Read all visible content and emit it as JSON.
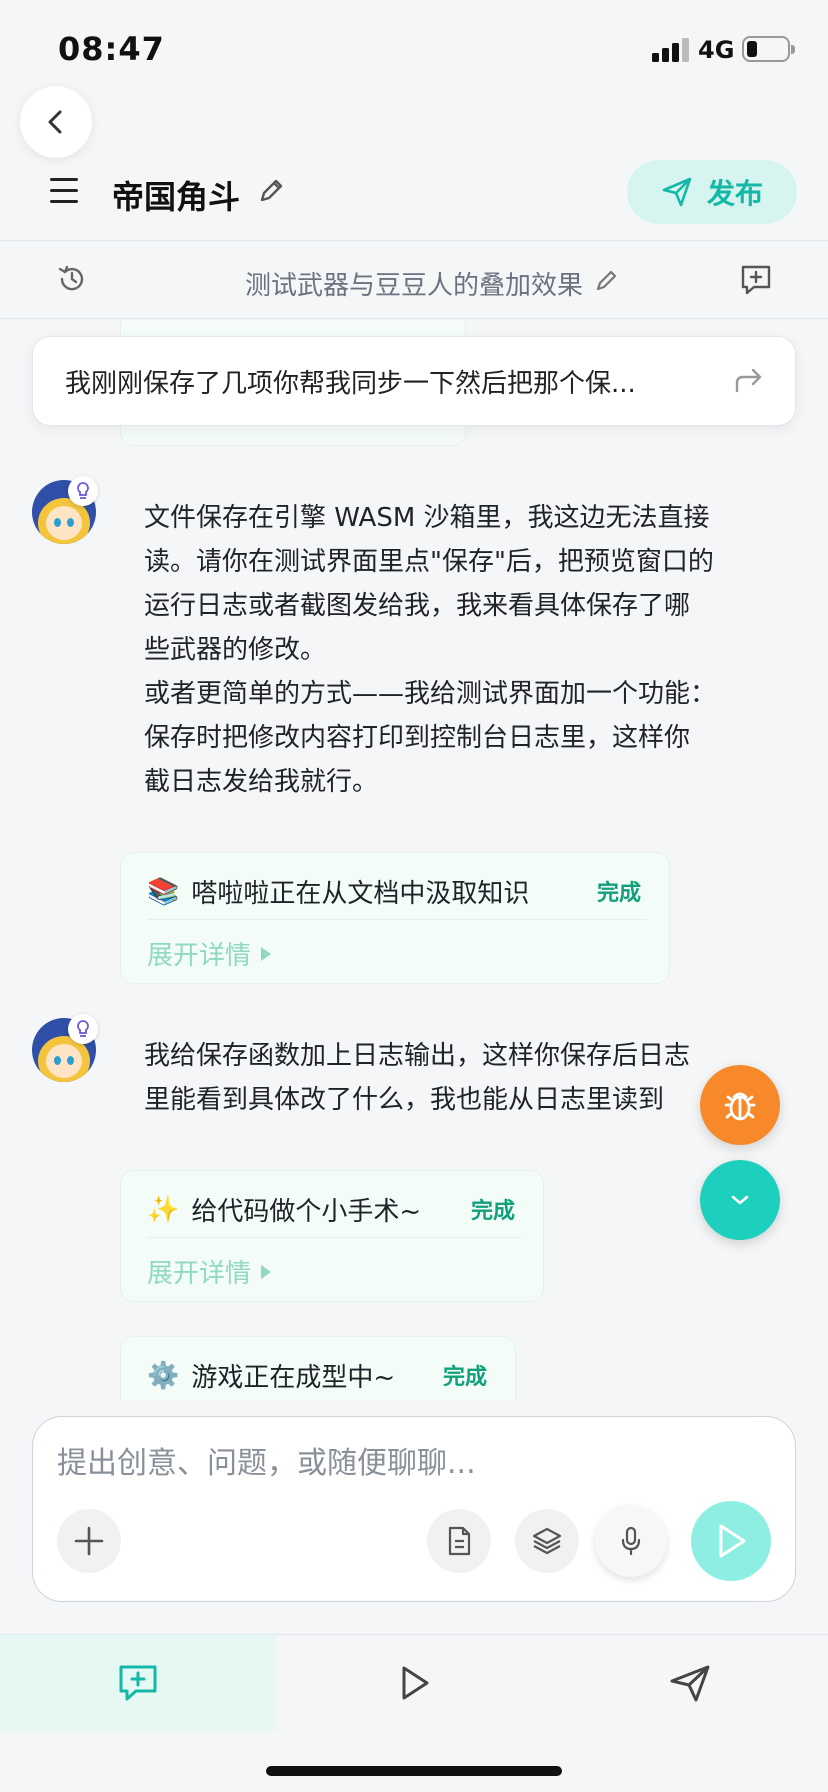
{
  "status_bar": {
    "time": "08:47",
    "network": "4G",
    "signal_bars": 3,
    "battery_level": 0.2
  },
  "header": {
    "title": "帝国角斗",
    "publish_label": "发布"
  },
  "subheader": {
    "title": "测试武器与豆豆人的叠加效果"
  },
  "pinned": {
    "text": "我刚刚保存了几项你帮我同步一下然后把那个保..."
  },
  "messages": [
    {
      "lines": [
        "文件保存在引擎 WASM 沙箱里，我这边无法直接",
        "读。请你在测试界面里点\"保存\"后，把预览窗口的",
        "运行日志或者截图发给我，我来看具体保存了哪",
        "些武器的修改。",
        "或者更简单的方式——我给测试界面加一个功能：",
        "保存时把修改内容打印到控制台日志里，这样你",
        "截日志发给我就行。"
      ]
    },
    {
      "lines": [
        "我给保存函数加上日志输出，这样你保存后日志",
        "里能看到具体改了什么，我也能从日志里读到"
      ]
    }
  ],
  "cards": [
    {
      "emoji": "📚",
      "title": "嗒啦啦正在从文档中汲取知识",
      "status": "完成",
      "expand": "展开详情"
    },
    {
      "emoji": "✨",
      "title": "给代码做个小手术~",
      "status": "完成",
      "expand": "展开详情"
    },
    {
      "emoji": "⚙️",
      "title": "游戏正在成型中~",
      "status": "完成"
    }
  ],
  "input": {
    "placeholder": "提出创意、问题，或随便聊聊..."
  },
  "icons": {
    "accent": "#14b8a6",
    "fab_bug": "#f7892b",
    "fab_down": "#1dcfbd"
  }
}
